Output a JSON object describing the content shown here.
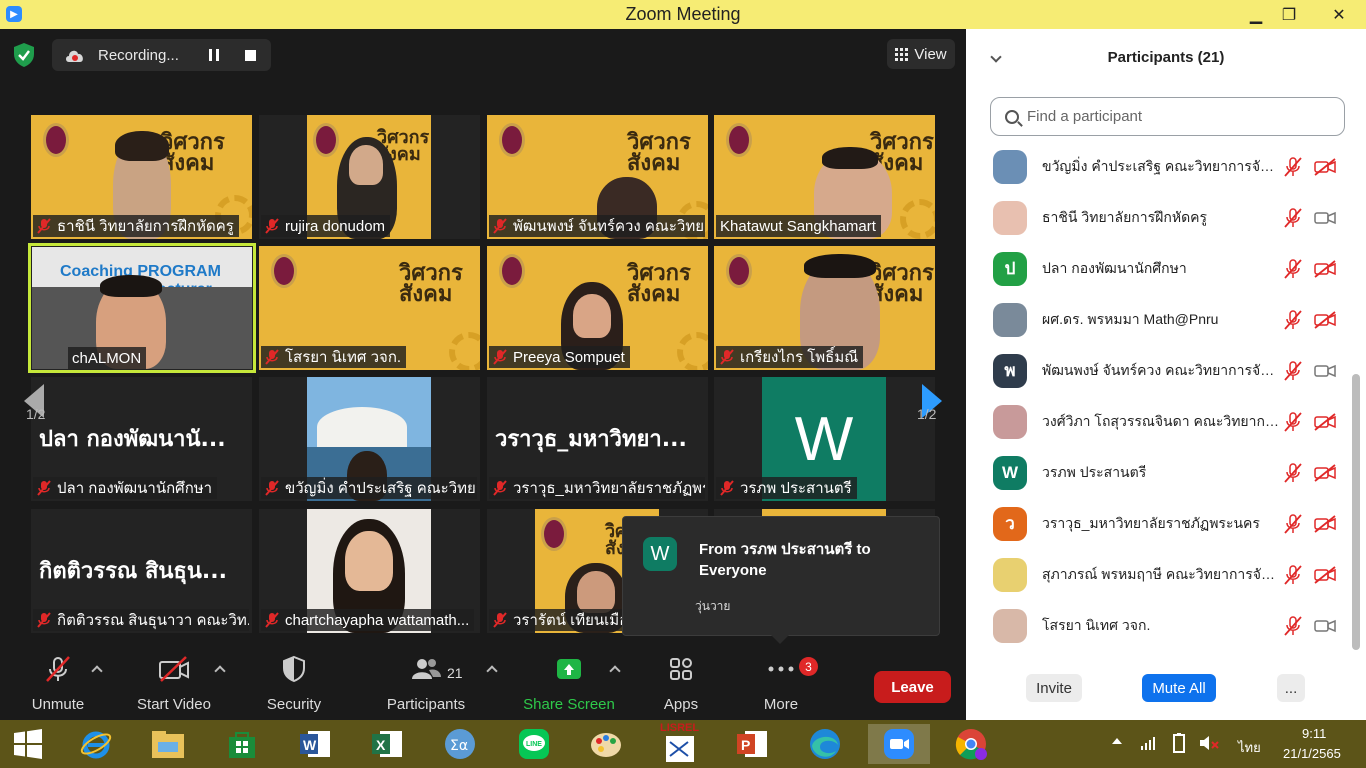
{
  "window": {
    "title": "Zoom Meeting",
    "minimize": "▁",
    "maximize": "❐",
    "close": "✕"
  },
  "top_bar": {
    "recording_label": "Recording...",
    "view_label": "View"
  },
  "pagination": {
    "left": "1/2",
    "right": "1/2"
  },
  "tiles": [
    {
      "name": "ธาชินี  วิทยาลัยการฝึกหัดครู",
      "type": "poster"
    },
    {
      "name": "rujira donudom",
      "type": "poster"
    },
    {
      "name": "พัฒนพงษ์ จันทร์ควง คณะวิทยา...",
      "type": "poster"
    },
    {
      "name": "Khatawut Sangkhamart",
      "type": "poster",
      "muted": false
    },
    {
      "name": "chALMON",
      "type": "coaching",
      "banner": "Coaching PROGRAM",
      "banner2": "for Lecturer",
      "muted": false
    },
    {
      "name": "โสรยา นิเทศ วจก.",
      "type": "poster"
    },
    {
      "name": "Preeya Sompuet",
      "type": "poster"
    },
    {
      "name": "เกรียงไกร โพธิ์มณี",
      "type": "poster"
    },
    {
      "name": "ปลา  กองพัฒนานักศึกษา",
      "type": "text",
      "big": "ปลา  กองพัฒนานั..."
    },
    {
      "name": "ขวัญมิ่ง คำประเสริฐ คณะวิทยา...",
      "type": "photo"
    },
    {
      "name": "วราวุธ_มหาวิทยาลัยราชภัฏพร...",
      "type": "text",
      "big": "วราวุธ_มหาวิทยา..."
    },
    {
      "name": "วรภพ ประสานตรี",
      "type": "avatar",
      "letter": "W"
    },
    {
      "name": "กิตติวรรณ สินธุนาวา คณะวิท...",
      "type": "text",
      "big": "กิตติวรรณ สินธุน..."
    },
    {
      "name": "chartchayapha wattamath...",
      "type": "photo2"
    },
    {
      "name": "วรารัตน์ เทียนเมือง",
      "type": "poster"
    },
    {
      "name": "",
      "type": "poster-partial"
    }
  ],
  "poster": {
    "brand_line1": "วิศวกร",
    "brand_line2": "สังคม"
  },
  "chat_toast": {
    "avatar": "W",
    "from": "From วรภพ ประสานตรี to Everyone",
    "message": "วุ่นวาย"
  },
  "toolbar": {
    "unmute": "Unmute",
    "start_video": "Start Video",
    "security": "Security",
    "participants": "Participants",
    "participants_count": "21",
    "share_screen": "Share Screen",
    "apps": "Apps",
    "more": "More",
    "more_badge": "3",
    "leave": "Leave"
  },
  "panel": {
    "title": "Participants (21)",
    "search_placeholder": "Find a participant",
    "participants": [
      {
        "name": "ขวัญมิ่ง คำประเสริฐ คณะวิทยาการจัดก...",
        "avatar": "",
        "color": "#6b8fb5",
        "video_off": true
      },
      {
        "name": "ธาชินี  วิทยาลัยการฝึกหัดครู",
        "avatar": "",
        "color": "#e8c0b0",
        "video_off": false
      },
      {
        "name": "ปลา  กองพัฒนานักศึกษา",
        "avatar": "ป",
        "color": "#22a045",
        "video_off": true
      },
      {
        "name": "ผศ.ดร. พรหมมา Math@Pnru",
        "avatar": "",
        "color": "#7a8a9a",
        "video_off": true
      },
      {
        "name": "พัฒนพงษ์ จันทร์ควง คณะวิทยาการจัด...",
        "avatar": "พ",
        "color": "#2f3c4c",
        "video_off": false
      },
      {
        "name": "วงศ์วิภา โถสุวรรณจินดา คณะวิทยาการ...",
        "avatar": "",
        "color": "#c89a9a",
        "video_off": true
      },
      {
        "name": "วรภพ ประสานตรี",
        "avatar": "W",
        "color": "#0f7c63",
        "video_off": true
      },
      {
        "name": "วราวุธ_มหาวิทยาลัยราชภัฏพระนคร",
        "avatar": "ว",
        "color": "#e2681a",
        "video_off": true
      },
      {
        "name": "สุภาภรณ์ พรหมฤาษี คณะวิทยาการจัด...",
        "avatar": "",
        "color": "#e8d070",
        "video_off": true
      },
      {
        "name": "โสรยา นิเทศ วจก.",
        "avatar": "",
        "color": "#d8b8a8",
        "video_off": false
      }
    ],
    "invite": "Invite",
    "mute_all": "Mute All",
    "more": "..."
  },
  "taskbar": {
    "lang": "ไทย",
    "time": "9:11",
    "date": "21/1/2565",
    "lisrel": "LISREL"
  }
}
